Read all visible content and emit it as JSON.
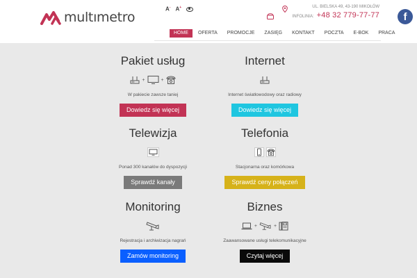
{
  "brand": {
    "name": "multımetro",
    "accent": "#c23355"
  },
  "accessibility": {
    "font_small": "A",
    "font_large": "A",
    "sup_small": "-",
    "sup_large": "+",
    "contrast_icon": "eye-icon"
  },
  "contact": {
    "address": "UL. BIELSKA 49, 43-190 MIKOŁÓW",
    "infoline_label": "INFOLINIA:",
    "phone": "+48 32 779-77-77"
  },
  "social": {
    "facebook_glyph": "f",
    "icon": "facebook-icon"
  },
  "nav": {
    "items": [
      "HOME",
      "OFERTA",
      "PROMOCJE",
      "ZASIĘG",
      "KONTAKT",
      "POCZTA",
      "E-BOK",
      "PRACA"
    ],
    "active": "HOME"
  },
  "tiles": [
    {
      "title": "Pakiet usług",
      "icons": [
        "router-icon",
        "monitor-icon",
        "phone-icon"
      ],
      "desc": "W pakiecie zawsze taniej",
      "button": "Dowiedz się więcej",
      "color": "#c23355"
    },
    {
      "title": "Internet",
      "icons": [
        "router-icon"
      ],
      "desc": "Internet światłowodowy oraz radiowy",
      "button": "Dowiedz się więcej",
      "color": "#1fc6e0"
    },
    {
      "title": "Telewizja",
      "icons": [
        "monitor-icon"
      ],
      "desc": "Ponad 300 kanałów do dyspozycji",
      "button": "Sprawdź kanały",
      "color": "#7a7a7a"
    },
    {
      "title": "Telefonia",
      "icons": [
        "mobile-icon",
        "phone-icon"
      ],
      "desc": "Stacjonarna oraz komórkowa",
      "button": "Sprawdź ceny połączeń",
      "color": "#d6b21a"
    },
    {
      "title": "Monitoring",
      "icons": [
        "camera-icon"
      ],
      "desc": "Rejestracja i archiwizacja nagrań",
      "button": "Zamów monitoring",
      "color": "#0a5fff"
    },
    {
      "title": "Biznes",
      "icons": [
        "laptop-icon",
        "camera-icon",
        "office-phone-icon"
      ],
      "desc": "Zaawansowane usługi telekomunikacyjne",
      "button": "Czytaj więcej",
      "color": "#0a0a0a"
    }
  ]
}
